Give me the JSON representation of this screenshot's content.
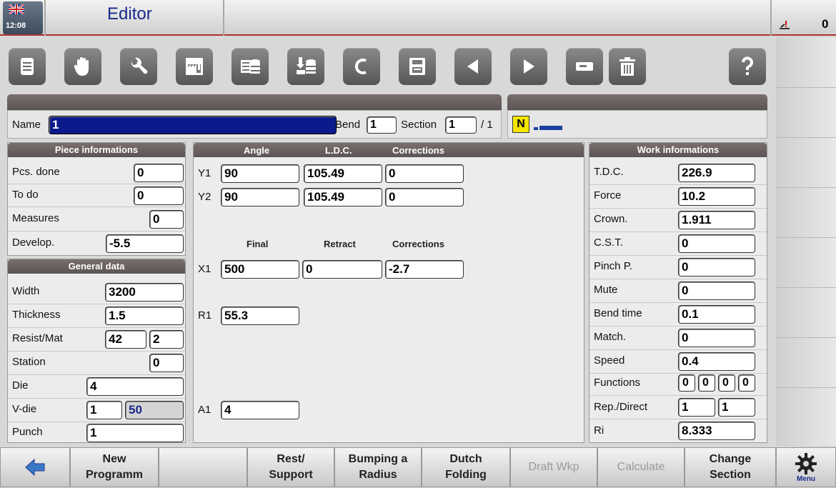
{
  "header": {
    "clock": "12:08",
    "title": "Editor",
    "counter": "0"
  },
  "toolbar": {
    "icons": [
      "document-icon",
      "hand-icon",
      "wrench-icon",
      "factory-icon",
      "list-database-icon",
      "import-database-icon",
      "c-icon",
      "save-icon",
      "left-arrow-icon",
      "right-arrow-icon",
      "minus-icon",
      "trash-icon",
      "help-icon"
    ]
  },
  "namebar": {
    "name_label": "Name",
    "name_value": "1",
    "bend_label": "Bend",
    "bend_value": "1",
    "section_label": "Section",
    "section_value": "1",
    "section_total": "/ 1",
    "mode_badge": "N"
  },
  "piece": {
    "title": "Piece informations",
    "rows": [
      {
        "label": "Pcs. done",
        "value": "0"
      },
      {
        "label": "To do",
        "value": "0"
      },
      {
        "label": "Measures",
        "value": "0"
      },
      {
        "label": "Develop.",
        "value": "-5.5"
      }
    ]
  },
  "general": {
    "title": "General data",
    "width_label": "Width",
    "width": "3200",
    "thickness_label": "Thickness",
    "thickness": "1.5",
    "resist_label": "Resist/Mat",
    "resist": "42",
    "mat": "2",
    "station_label": "Station",
    "station": "0",
    "die_label": "Die",
    "die": "4",
    "vdie_label": "V-die",
    "vdie1": "1",
    "vdie2": "50",
    "punch_label": "Punch",
    "punch": "1"
  },
  "axes": {
    "col_angle": "Angle",
    "col_ldc": "L.D.C.",
    "col_corr": "Corrections",
    "y1_label": "Y1",
    "y1_angle": "90",
    "y1_ldc": "105.49",
    "y1_corr": "0",
    "y2_label": "Y2",
    "y2_angle": "90",
    "y2_ldc": "105.49",
    "y2_corr": "0",
    "col_final": "Final",
    "col_retract": "Retract",
    "col_corr2": "Corrections",
    "x1_label": "X1",
    "x1_final": "500",
    "x1_retract": "0",
    "x1_corr": "-2.7",
    "r1_label": "R1",
    "r1": "55.3",
    "a1_label": "A1",
    "a1": "4"
  },
  "work": {
    "title": "Work informations",
    "rows": [
      {
        "label": "T.D.C.",
        "value": "226.9"
      },
      {
        "label": "Force",
        "value": "10.2"
      },
      {
        "label": "Crown.",
        "value": "1.911"
      },
      {
        "label": "C.S.T.",
        "value": "0"
      },
      {
        "label": "Pinch P.",
        "value": "0"
      },
      {
        "label": "Mute",
        "value": "0"
      },
      {
        "label": "Bend time",
        "value": "0.1"
      },
      {
        "label": "Match.",
        "value": "0"
      },
      {
        "label": "Speed",
        "value": "0.4"
      }
    ],
    "functions_label": "Functions",
    "functions": [
      "0",
      "0",
      "0",
      "0"
    ],
    "repdirect_label": "Rep./Direct",
    "rep": "1",
    "direct": "1",
    "ri_label": "Ri",
    "ri": "8.333"
  },
  "bottom": {
    "new_programm": "New\nProgramm",
    "rest_support": "Rest/\nSupport",
    "bumping": "Bumping a\nRadius",
    "dutch": "Dutch\nFolding",
    "draft": "Draft Wkp",
    "calculate": "Calculate",
    "change_section": "Change\nSection",
    "menu": "Menu"
  },
  "colors": {
    "title_blue": "#1a2a8a",
    "name_field": "#0a1a8a",
    "panel_header": "#6a6060",
    "badge_yellow": "#f5e600"
  }
}
